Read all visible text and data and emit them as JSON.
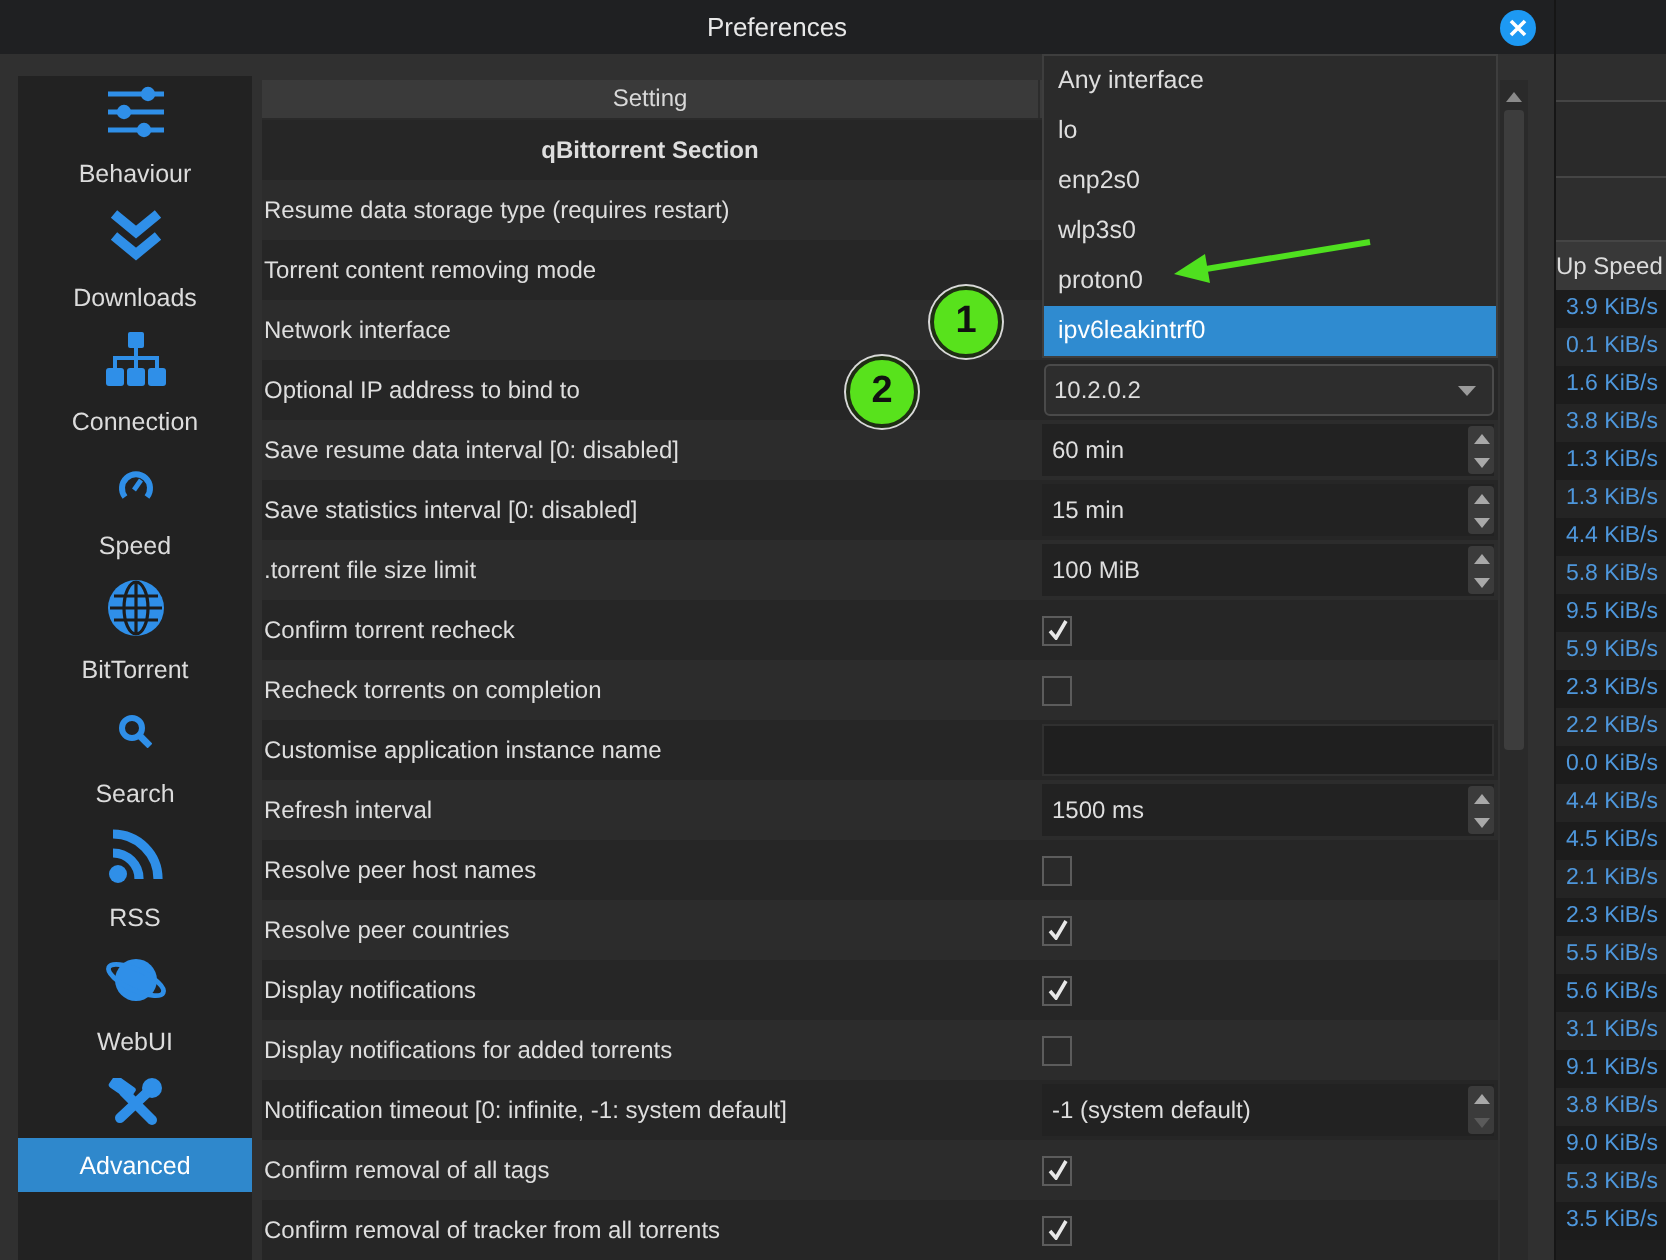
{
  "window": {
    "title": "Preferences"
  },
  "sidebar": {
    "items": [
      {
        "label": "Behaviour",
        "selected": false
      },
      {
        "label": "Downloads",
        "selected": false
      },
      {
        "label": "Connection",
        "selected": false
      },
      {
        "label": "Speed",
        "selected": false
      },
      {
        "label": "BitTorrent",
        "selected": false
      },
      {
        "label": "Search",
        "selected": false
      },
      {
        "label": "RSS",
        "selected": false
      },
      {
        "label": "WebUI",
        "selected": false
      },
      {
        "label": "Advanced",
        "selected": true
      }
    ]
  },
  "table": {
    "columns": [
      {
        "label": "Setting"
      }
    ],
    "rows": [
      {
        "kind": "section",
        "label": "qBittorrent Section"
      },
      {
        "kind": "plain",
        "label": "Resume data storage type (requires restart)"
      },
      {
        "kind": "plain",
        "label": "Torrent content removing mode"
      },
      {
        "kind": "dropdown",
        "label": "Network interface",
        "expanded": true,
        "options": [
          {
            "label": "Any interface",
            "selected": false
          },
          {
            "label": "lo",
            "selected": false
          },
          {
            "label": "enp2s0",
            "selected": false
          },
          {
            "label": "wlp3s0",
            "selected": false
          },
          {
            "label": "proton0",
            "selected": false
          },
          {
            "label": "ipv6leakintrf0",
            "selected": true
          }
        ]
      },
      {
        "kind": "combo",
        "label": "Optional IP address to bind to",
        "value": "10.2.0.2"
      },
      {
        "kind": "spin",
        "label": "Save resume data interval [0: disabled]",
        "value": "60 min",
        "down_disabled": false
      },
      {
        "kind": "spin",
        "label": "Save statistics interval [0: disabled]",
        "value": "15 min",
        "down_disabled": false
      },
      {
        "kind": "spin",
        "label": ".torrent file size limit",
        "value": "100 MiB",
        "down_disabled": false
      },
      {
        "kind": "checkbox",
        "label": "Confirm torrent recheck",
        "checked": true
      },
      {
        "kind": "checkbox",
        "label": "Recheck torrents on completion",
        "checked": false
      },
      {
        "kind": "text",
        "label": "Customise application instance name"
      },
      {
        "kind": "spin",
        "label": "Refresh interval",
        "value": "1500 ms",
        "down_disabled": false
      },
      {
        "kind": "checkbox",
        "label": "Resolve peer host names",
        "checked": false
      },
      {
        "kind": "checkbox",
        "label": "Resolve peer countries",
        "checked": true
      },
      {
        "kind": "checkbox",
        "label": "Display notifications",
        "checked": true
      },
      {
        "kind": "checkbox",
        "label": "Display notifications for added torrents",
        "checked": false
      },
      {
        "kind": "spin",
        "label": "Notification timeout [0: infinite, -1: system default]",
        "value": "-1 (system default)",
        "down_disabled": true
      },
      {
        "kind": "checkbox",
        "label": "Confirm removal of all tags",
        "checked": true
      },
      {
        "kind": "checkbox",
        "label": "Confirm removal of tracker from all torrents",
        "checked": true
      }
    ]
  },
  "annotations": [
    {
      "label": "1"
    },
    {
      "label": "2"
    }
  ],
  "background_window": {
    "column_header": "Up Speed",
    "values": [
      "3.9 KiB/s",
      "0.1 KiB/s",
      "1.6 KiB/s",
      "3.8 KiB/s",
      "1.3 KiB/s",
      "1.3 KiB/s",
      "4.4 KiB/s",
      "5.8 KiB/s",
      "9.5 KiB/s",
      "5.9 KiB/s",
      "2.3 KiB/s",
      "2.2 KiB/s",
      "0.0 KiB/s",
      "4.4 KiB/s",
      "4.5 KiB/s",
      "2.1 KiB/s",
      "2.3 KiB/s",
      "5.5 KiB/s",
      "5.6 KiB/s",
      "3.1 KiB/s",
      "9.1 KiB/s",
      "3.8 KiB/s",
      "9.0 KiB/s",
      "5.3 KiB/s",
      "3.5 KiB/s"
    ]
  }
}
